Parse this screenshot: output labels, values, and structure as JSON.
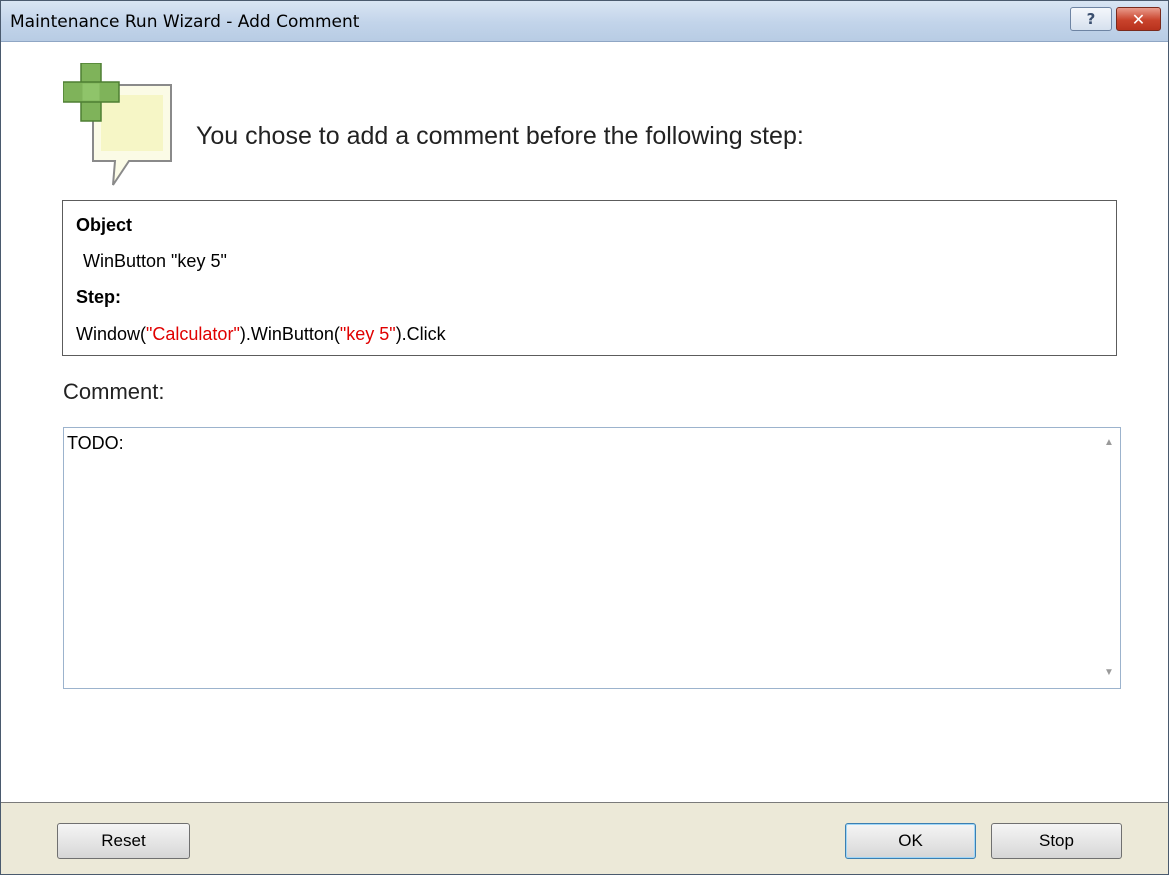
{
  "window": {
    "title": "Maintenance Run Wizard - Add Comment",
    "help_glyph": "?",
    "close_glyph": "✕"
  },
  "header": {
    "icon": "add-comment-icon",
    "message": "You chose to add a comment before the following step:"
  },
  "step_info": {
    "object_label": "Object",
    "object_value": "WinButton \"key 5\"",
    "step_label": "Step:",
    "step_parts": {
      "p1": "Window(",
      "s1": "\"Calculator\"",
      "p2": ").WinButton(",
      "s2": "\"key 5\"",
      "p3": ").Click"
    }
  },
  "comment": {
    "label": "Comment:",
    "value": "TODO:"
  },
  "buttons": {
    "reset": "Reset",
    "ok": "OK",
    "stop": "Stop"
  },
  "colors": {
    "string_literal": "#e00000",
    "titlebar": "#c2d4ea",
    "footer": "#ece9d8"
  }
}
